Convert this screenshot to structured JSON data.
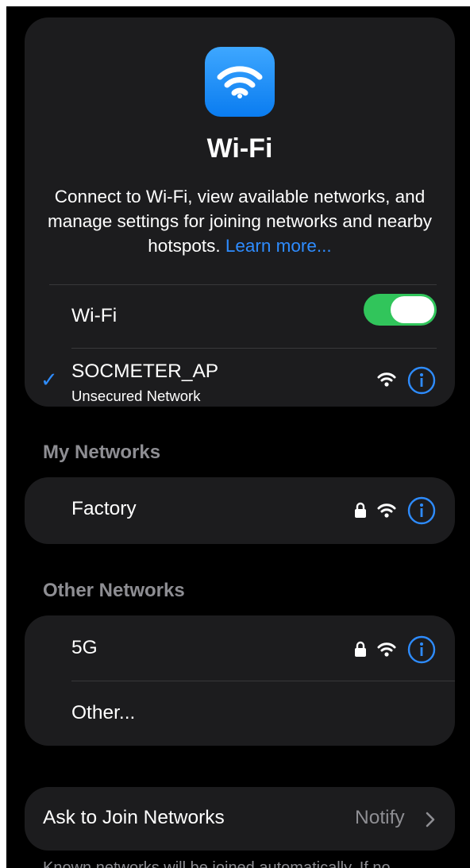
{
  "header": {
    "icon": "wifi-app-icon",
    "title": "Wi-Fi",
    "description": "Connect to Wi-Fi, view available networks, and manage settings for joining networks and nearby hotspots.",
    "learn_more": "Learn more..."
  },
  "wifi_toggle": {
    "label": "Wi-Fi",
    "on": true
  },
  "connected": {
    "name": "SOCMETER_AP",
    "subtitle": "Unsecured Network",
    "icons": [
      "checkmark-icon",
      "wifi-signal-icon",
      "info-icon"
    ]
  },
  "my_networks": {
    "title": "My Networks",
    "items": [
      {
        "name": "Factory",
        "icons": [
          "lock-icon",
          "wifi-signal-icon",
          "info-icon"
        ]
      }
    ]
  },
  "other_networks": {
    "title": "Other Networks",
    "items": [
      {
        "name": "5G",
        "icons": [
          "lock-icon",
          "wifi-signal-icon",
          "info-icon"
        ]
      },
      {
        "name": "Other..."
      }
    ]
  },
  "ask_to_join": {
    "label": "Ask to Join Networks",
    "value": "Notify"
  },
  "footer_partial": "Known networks will be joined automatically. If no",
  "colors": {
    "background": "#000000",
    "card": "#1c1c1e",
    "accent": "#2e8cff",
    "toggle_on": "#31c55b",
    "secondary_text": "#8e8e93"
  }
}
